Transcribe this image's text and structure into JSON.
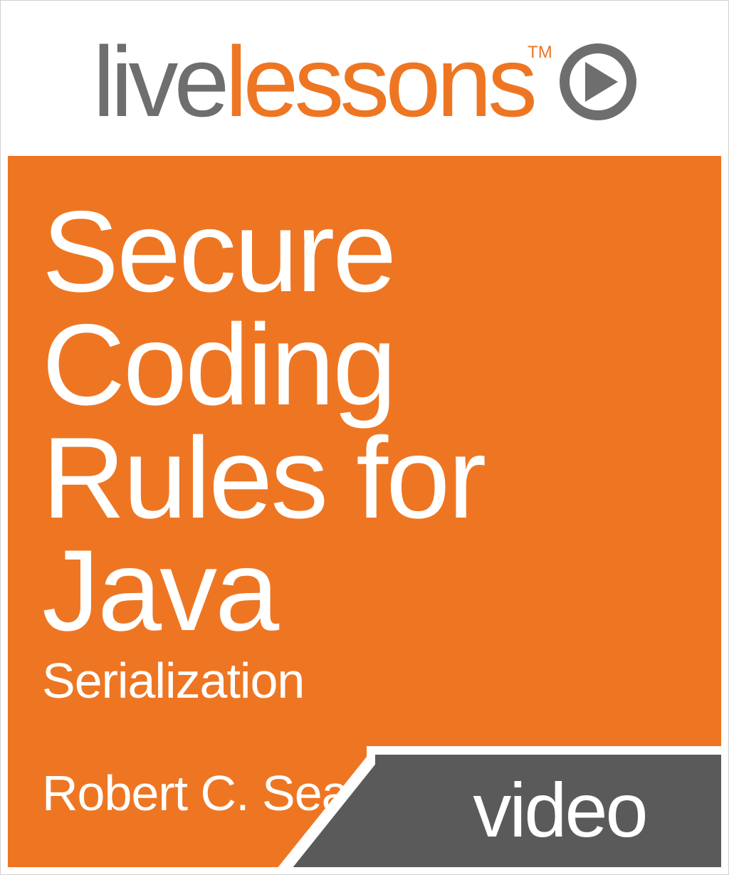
{
  "brand": {
    "part1": "live",
    "part2": "lessons",
    "trademark": "TM"
  },
  "cover": {
    "title": "Secure Coding Rules for Java",
    "subtitle": "Serialization",
    "author": "Robert C. Seacord",
    "format_label": "video"
  },
  "colors": {
    "accent": "#ee7623",
    "brand_gray": "#6e6e6e",
    "tab_gray": "#5a5a5a",
    "white": "#ffffff"
  },
  "icons": {
    "play": "play-icon"
  }
}
